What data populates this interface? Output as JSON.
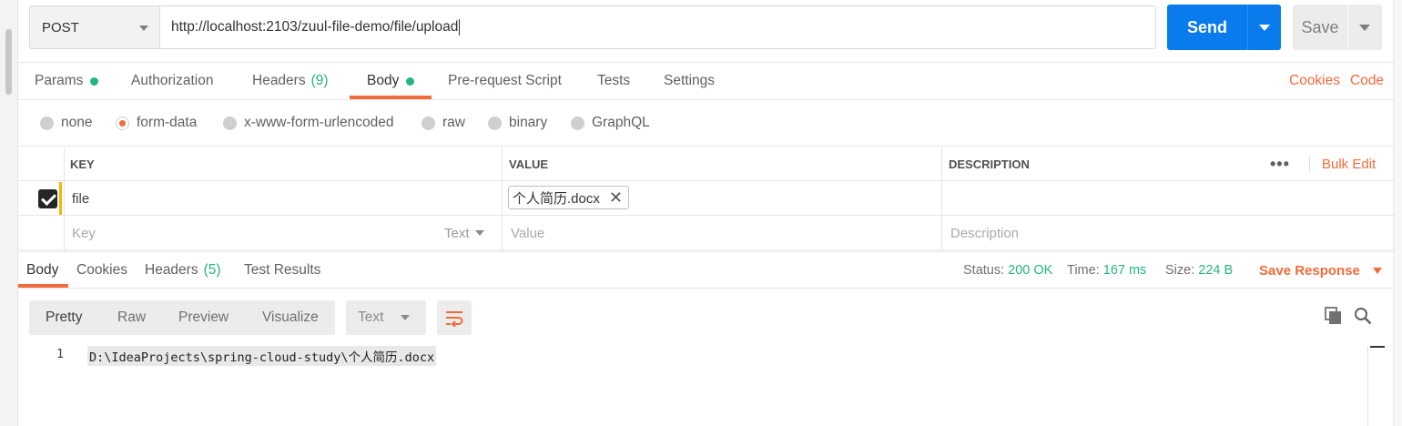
{
  "request": {
    "method": "POST",
    "url": "http://localhost:2103/zuul-file-demo/file/upload",
    "send_label": "Send",
    "save_label": "Save"
  },
  "request_tabs": {
    "params": "Params",
    "authorization": "Authorization",
    "headers": "Headers",
    "headers_count": "(9)",
    "body": "Body",
    "pre_request": "Pre-request Script",
    "tests": "Tests",
    "settings": "Settings",
    "cookies": "Cookies",
    "code": "Code"
  },
  "body_types": {
    "none": "none",
    "form_data": "form-data",
    "urlencoded": "x-www-form-urlencoded",
    "raw": "raw",
    "binary": "binary",
    "graphql": "GraphQL",
    "selected": "form-data"
  },
  "form_table": {
    "headers": {
      "key": "KEY",
      "value": "VALUE",
      "description": "DESCRIPTION"
    },
    "bulk_edit": "Bulk Edit",
    "more": "•••",
    "rows": [
      {
        "key": "file",
        "value": "个人简历.docx",
        "checked": true
      }
    ],
    "new_row": {
      "key_placeholder": "Key",
      "type": "Text",
      "value_placeholder": "Value",
      "description_placeholder": "Description"
    }
  },
  "response": {
    "tabs": {
      "body": "Body",
      "cookies": "Cookies",
      "headers": "Headers",
      "headers_count": "(5)",
      "test_results": "Test Results"
    },
    "status_label": "Status:",
    "status": "200 OK",
    "time_label": "Time:",
    "time": "167 ms",
    "size_label": "Size:",
    "size": "224 B",
    "save_response": "Save Response",
    "views": {
      "pretty": "Pretty",
      "raw": "Raw",
      "preview": "Preview",
      "visualize": "Visualize"
    },
    "format": "Text",
    "lines": [
      {
        "number": "1",
        "text": "D:\\IdeaProjects\\spring-cloud-study\\个人简历.docx"
      }
    ]
  },
  "colors": {
    "accent": "#f26b3a",
    "primary": "#097bed",
    "success": "#26b47f",
    "marker": "#f5b700"
  }
}
